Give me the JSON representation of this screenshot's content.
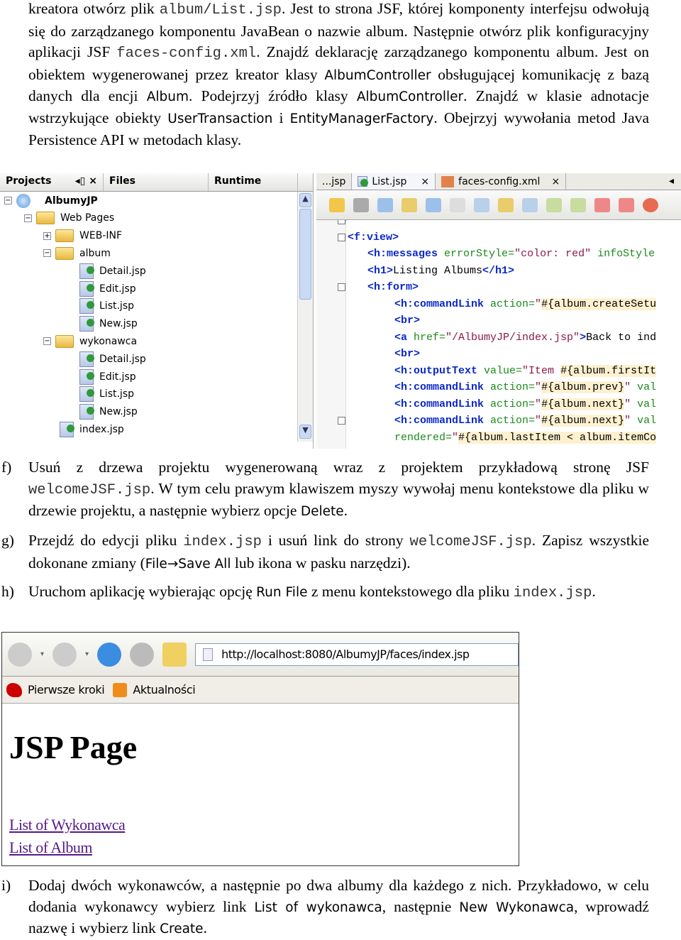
{
  "intro": [
    [
      "r",
      "kreatora otwórz plik "
    ],
    [
      "m",
      "album/List.jsp"
    ],
    [
      "r",
      ". Jest to strona JSF, której komponenty interfejsu  odwołują się do zarządzanego komponentu JavaBean o nazwie album. Następnie otwórz plik konfiguracyjny aplikacji JSF "
    ],
    [
      "m",
      "faces-config.xml"
    ],
    [
      "r",
      ". Znajdź deklarację zarządzanego komponentu album. Jest on obiektem wygenerowanej przez kreator klasy "
    ],
    [
      "s",
      "AlbumController"
    ],
    [
      "r",
      " obsługującej komunikację z bazą danych dla encji "
    ],
    [
      "s",
      "Album"
    ],
    [
      "r",
      ". Podejrzyj źródło klasy "
    ],
    [
      "s",
      "AlbumController"
    ],
    [
      "r",
      ". Znajdź w klasie adnotacje wstrzykujące obiekty "
    ],
    [
      "s",
      "UserTransaction"
    ],
    [
      "r",
      " i "
    ],
    [
      "s",
      "EntityManagerFactory"
    ],
    [
      "r",
      ". Obejrzyj wywołania metod Java Persistence API w metodach klasy."
    ]
  ],
  "ide": {
    "panel_tabs": [
      "Projects",
      "Files",
      "Runtime"
    ],
    "tree": [
      {
        "label": "AlbumyJP",
        "kind": "project",
        "level": 0,
        "exp": "−"
      },
      {
        "label": "Web Pages",
        "kind": "folder",
        "level": 1,
        "exp": "−"
      },
      {
        "label": "WEB-INF",
        "kind": "folder",
        "level": 2,
        "exp": "+"
      },
      {
        "label": "album",
        "kind": "folder",
        "level": 2,
        "exp": "−"
      },
      {
        "label": "Detail.jsp",
        "kind": "jsp",
        "level": 3
      },
      {
        "label": "Edit.jsp",
        "kind": "jsp",
        "level": 3
      },
      {
        "label": "List.jsp",
        "kind": "jsp",
        "level": 3
      },
      {
        "label": "New.jsp",
        "kind": "jsp",
        "level": 3
      },
      {
        "label": "wykonawca",
        "kind": "folder",
        "level": 2,
        "exp": "−"
      },
      {
        "label": "Detail.jsp",
        "kind": "jsp",
        "level": 3
      },
      {
        "label": "Edit.jsp",
        "kind": "jsp",
        "level": 3
      },
      {
        "label": "List.jsp",
        "kind": "jsp",
        "level": 3
      },
      {
        "label": "New.jsp",
        "kind": "jsp",
        "level": 3
      },
      {
        "label": "index.jsp",
        "kind": "jsp",
        "level": 2
      }
    ],
    "editor_tabs": [
      "...jsp",
      "List.jsp",
      "faces-config.xml"
    ],
    "code": [
      [
        [
          "t",
          ">"
        ]
      ],
      [
        [
          "t",
          "<f:view>"
        ]
      ],
      [
        [
          "t",
          "<h:messages"
        ],
        [
          "a",
          " errorStyle="
        ],
        [
          "v",
          "\"color: red\""
        ],
        [
          "a",
          " infoStyle"
        ]
      ],
      [
        [
          "t",
          "<h1>"
        ],
        [
          "x",
          "Listing Albums"
        ],
        [
          "t",
          "</h1>"
        ]
      ],
      [
        [
          "t",
          "<h:form>"
        ]
      ],
      [
        [
          "t",
          "<h:commandLink"
        ],
        [
          "a",
          " action="
        ],
        [
          "v",
          "\""
        ],
        [
          "e",
          "#{album.createSetu"
        ]
      ],
      [
        [
          "t",
          "<br>"
        ]
      ],
      [
        [
          "t",
          "<a"
        ],
        [
          "a",
          " href="
        ],
        [
          "v",
          "\"/AlbumyJP/index.jsp\""
        ],
        [
          "t",
          ">"
        ],
        [
          "x",
          "Back to ind"
        ]
      ],
      [
        [
          "t",
          "<br>"
        ]
      ],
      [
        [
          "t",
          "<h:outputText"
        ],
        [
          "a",
          " value="
        ],
        [
          "v",
          "\"Item "
        ],
        [
          "e",
          "#{album.firstIt"
        ]
      ],
      [
        [
          "t",
          "<h:commandLink"
        ],
        [
          "a",
          " action="
        ],
        [
          "v",
          "\""
        ],
        [
          "e",
          "#{album.prev}"
        ],
        [
          "v",
          "\""
        ],
        [
          "a",
          " val"
        ]
      ],
      [
        [
          "t",
          "<h:commandLink"
        ],
        [
          "a",
          " action="
        ],
        [
          "v",
          "\""
        ],
        [
          "e",
          "#{album.next}"
        ],
        [
          "v",
          "\""
        ],
        [
          "a",
          " val"
        ]
      ],
      [
        [
          "t",
          "<h:commandLink"
        ],
        [
          "a",
          " action="
        ],
        [
          "v",
          "\""
        ],
        [
          "e",
          "#{album.next}"
        ],
        [
          "v",
          "\""
        ],
        [
          "a",
          " val"
        ]
      ],
      [
        [
          "a",
          "rendered="
        ],
        [
          "v",
          "\""
        ],
        [
          "e",
          "#{album.lastItem < album.itemCo"
        ]
      ]
    ]
  },
  "steps": {
    "f": {
      "label": "f)",
      "text": [
        [
          "r",
          "Usuń z drzewa projektu wygenerowaną wraz z projektem przykładową stronę JSF "
        ],
        [
          "m",
          "welcomeJSF.jsp"
        ],
        [
          "r",
          ". W tym celu prawym klawiszem myszy wywołaj menu kontekstowe dla pliku w drzewie projektu, a następnie wybierz opcje "
        ],
        [
          "s",
          "Delete"
        ],
        [
          "r",
          "."
        ]
      ]
    },
    "g": {
      "label": "g)",
      "text": [
        [
          "r",
          "Przejdź do edycji pliku "
        ],
        [
          "m",
          "index.jsp"
        ],
        [
          "r",
          " i usuń link do strony "
        ],
        [
          "m",
          "welcomeJSF.jsp"
        ],
        [
          "r",
          ". Zapisz wszystkie dokonane zmiany ("
        ],
        [
          "s",
          "File→Save All"
        ],
        [
          "r",
          " lub ikona w pasku narzędzi)."
        ]
      ]
    },
    "h": {
      "label": "h)",
      "text": [
        [
          "r",
          "Uruchom aplikację wybierając opcję "
        ],
        [
          "s",
          "Run File"
        ],
        [
          "r",
          " z menu kontekstowego dla pliku "
        ],
        [
          "m",
          "index.jsp"
        ],
        [
          "r",
          "."
        ]
      ]
    },
    "i": {
      "label": "i)",
      "text": [
        [
          "r",
          "Dodaj dwóch wykonawców, a następnie po dwa albumy dla każdego z nich. Przykładowo, w celu dodania wykonawcy wybierz link "
        ],
        [
          "s",
          "List of wykonawca"
        ],
        [
          "r",
          ", następnie "
        ],
        [
          "s",
          "New Wykonawca"
        ],
        [
          "r",
          ", wprowadź nazwę i wybierz link "
        ],
        [
          "s",
          "Create"
        ],
        [
          "r",
          "."
        ]
      ]
    }
  },
  "browser": {
    "url": "http://localhost:8080/AlbumyJP/faces/index.jsp",
    "bookmarks": [
      "Pierwsze kroki",
      "Aktualności"
    ],
    "heading": "JSP Page",
    "links": [
      "List of Wykonawca",
      "List of Album"
    ]
  }
}
